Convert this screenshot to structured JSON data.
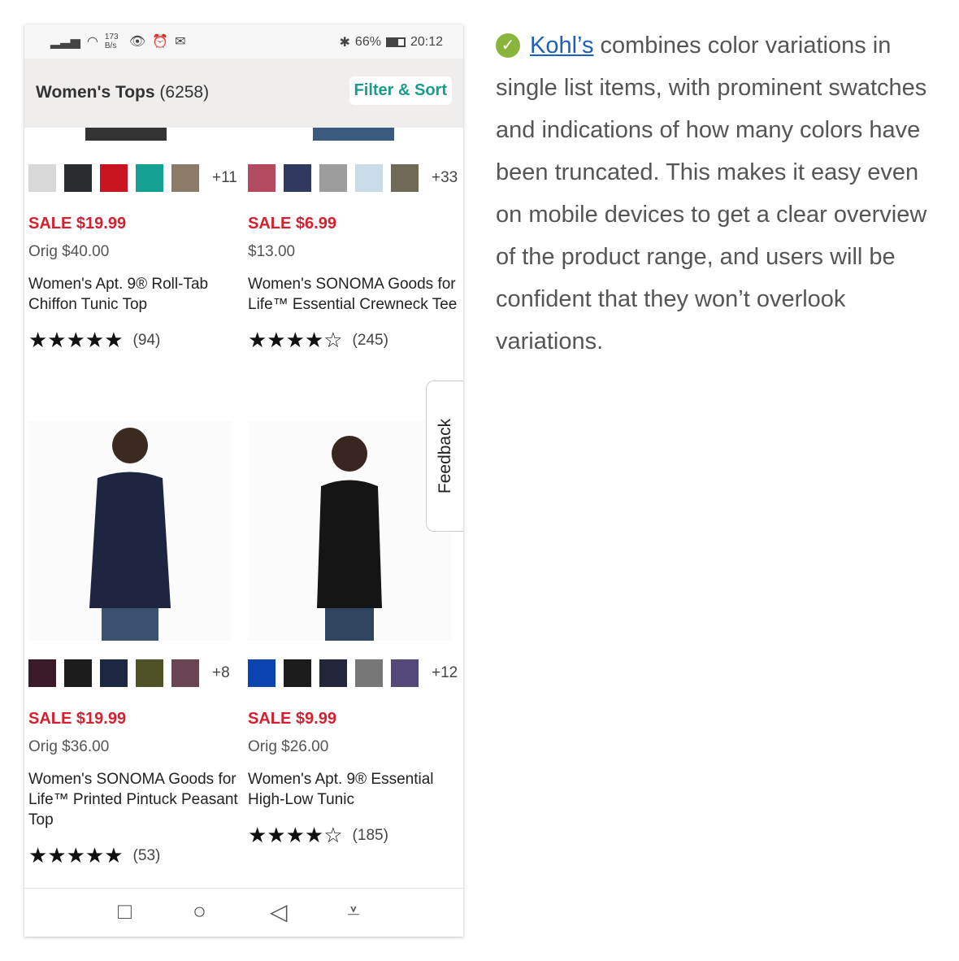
{
  "status_bar": {
    "net_speed": "173 B/s",
    "battery": "66%",
    "time": "20:12"
  },
  "header": {
    "title": "Women's Tops",
    "count": "(6258)",
    "filter_label": "Filter & Sort"
  },
  "products": [
    {
      "swatches": [
        "#d8d8d8",
        "#2b2c30",
        "#c8141e",
        "#14a092",
        "#8a7a68"
      ],
      "more": "+11",
      "sale": "SALE $19.99",
      "orig": "Orig $40.00",
      "name": "Women's Apt. 9® Roll-Tab Chiffon Tunic Top",
      "stars": "★★★★★",
      "rating": 4.5,
      "count": "(94)"
    },
    {
      "swatches": [
        "#b44a60",
        "#2f3a5e",
        "#9d9d9d",
        "#c9dbe6",
        "#6f6a55"
      ],
      "more": "+33",
      "sale": "SALE $6.99",
      "orig": "$13.00",
      "name": "Women's SONOMA Goods for Life™ Essential Crewneck Tee",
      "stars": "★★★★☆",
      "rating": 4.5,
      "count": "(245)"
    },
    {
      "swatches": [
        "#3b1a2a",
        "#1c1c1c",
        "#1d2741",
        "#4f5226",
        "#6a4453"
      ],
      "more": "+8",
      "sale": "SALE $19.99",
      "orig": "Orig $36.00",
      "name": "Women's SONOMA Goods for Life™ Printed Pintuck Peasant Top",
      "stars": "★★★★★",
      "rating": 5,
      "count": "(53)"
    },
    {
      "swatches": [
        "#0b43b0",
        "#1c1c1c",
        "#23253b",
        "#777777",
        "#54487a"
      ],
      "more": "+12",
      "sale": "SALE $9.99",
      "orig": "Orig $26.00",
      "name": "Women's Apt. 9® Essential High-Low Tunic",
      "stars": "★★★★☆",
      "rating": 4.5,
      "count": "(185)"
    }
  ],
  "feedback_label": "Feedback",
  "nav": {
    "recent": "□",
    "home": "○",
    "back": "◁",
    "menu": "⩡"
  },
  "note": {
    "link": "Kohl’s",
    "text": " combines color variations in single list items, with prominent swatches and indications of how many colors have been truncated. This makes it easy even on mobile devices to get a clear overview of the product range, and users will be confident that they won’t overlook variations."
  }
}
